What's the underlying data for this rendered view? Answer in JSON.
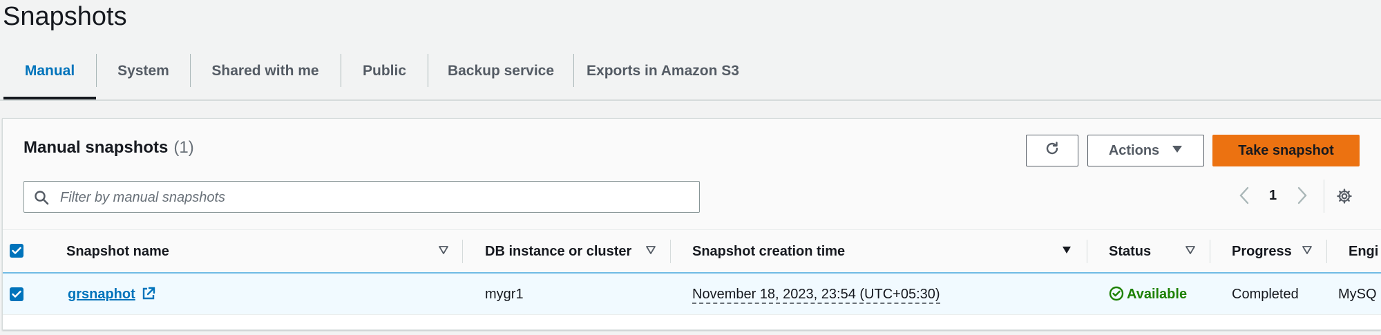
{
  "page": {
    "title": "Snapshots"
  },
  "tabs": [
    {
      "label": "Manual",
      "active": true
    },
    {
      "label": "System"
    },
    {
      "label": "Shared with me"
    },
    {
      "label": "Public"
    },
    {
      "label": "Backup service"
    },
    {
      "label": "Exports in Amazon S3"
    }
  ],
  "panel": {
    "title": "Manual snapshots",
    "count": "(1)",
    "actions_label": "Actions",
    "primary_label": "Take snapshot",
    "filter_placeholder": "Filter by manual snapshots",
    "filter_value": "",
    "page_number": "1"
  },
  "table": {
    "columns": [
      "Snapshot name",
      "DB instance or cluster",
      "Snapshot creation time",
      "Status",
      "Progress",
      "Engi"
    ],
    "rows": [
      {
        "name": "grsnaphot",
        "instance": "mygr1",
        "created": "November 18, 2023, 23:54 (UTC+05:30)",
        "status": "Available",
        "progress": "Completed",
        "engine": "MySQ"
      }
    ]
  },
  "colors": {
    "accent": "#0073bb",
    "primary_button": "#ec7211",
    "success": "#1d8102"
  },
  "icons": {
    "refresh": "refresh-icon",
    "search": "search-icon",
    "settings": "gear-icon",
    "external": "external-link-icon",
    "status": "check-circle-icon"
  }
}
